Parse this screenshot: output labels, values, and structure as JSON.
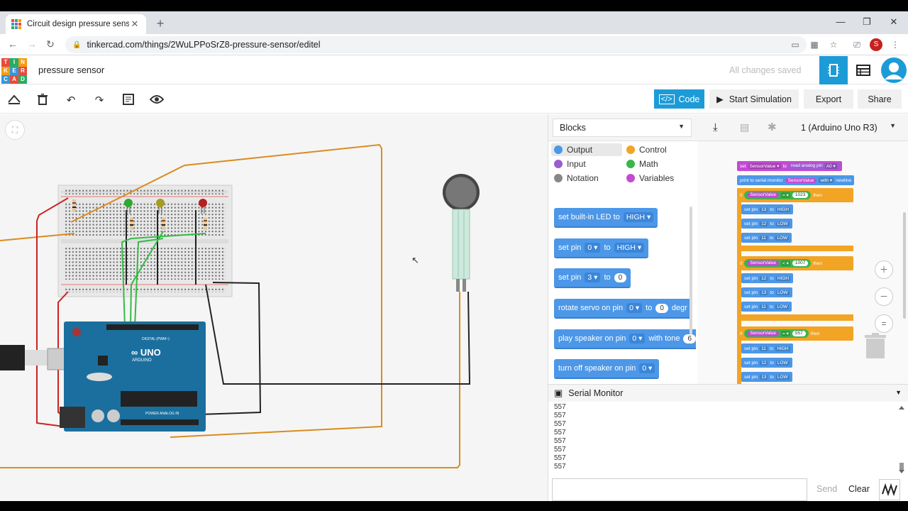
{
  "browser": {
    "tab_title": "Circuit design pressure sensor | T",
    "url": "tinkercad.com/things/2WuLPPoSrZ8-pressure-sensor/editel",
    "profile_initial": "S"
  },
  "app": {
    "logo_letters": [
      "T",
      "I",
      "N",
      "K",
      "E",
      "R",
      "C",
      "A",
      "D"
    ],
    "project_name": "pressure sensor",
    "save_status": "All changes saved"
  },
  "toolbar": {
    "code_label": "Code",
    "simulation_label": "Start Simulation",
    "export_label": "Export",
    "share_label": "Share"
  },
  "code_panel": {
    "mode_selected": "Blocks",
    "device_selected": "1 (Arduino Uno R3)",
    "categories": [
      "Output",
      "Control",
      "Input",
      "Math",
      "Notation",
      "Variables"
    ],
    "category_colors": {
      "Output": "#4c97e8",
      "Control": "#f2a424",
      "Input": "#9a5cd0",
      "Math": "#3cb54b",
      "Notation": "#888888",
      "Variables": "#c24bd3"
    },
    "palette": [
      {
        "text": "set built-in LED to",
        "dd": "HIGH"
      },
      {
        "text": "set pin",
        "dd": "0",
        "text2": "to",
        "dd2": "HIGH"
      },
      {
        "text": "set pin",
        "dd": "3",
        "text2": "to",
        "num": "0"
      },
      {
        "text": "rotate servo on pin",
        "dd": "0",
        "text2": "to",
        "num": "0",
        "text3": "degr"
      },
      {
        "text": "play speaker on pin",
        "dd": "0",
        "text2": "with tone",
        "num": "6"
      },
      {
        "text": "turn off speaker on pin",
        "dd": "0"
      }
    ],
    "workspace": {
      "set_label": "set",
      "var": "SensorValue",
      "to": "to",
      "read": "read analog pin",
      "pin": "A0",
      "print": "print to serial monitor",
      "with": "with",
      "newline": "newline",
      "if": "if",
      "then": "then",
      "eq": "=",
      "thresholds": [
        "1023",
        "1007",
        "557"
      ],
      "setpin": "set pin",
      "high": "HIGH",
      "low": "LOW",
      "groups": [
        [
          [
            "13",
            "HIGH"
          ],
          [
            "12",
            "LOW"
          ],
          [
            "11",
            "LOW"
          ]
        ],
        [
          [
            "12",
            "HIGH"
          ],
          [
            "13",
            "LOW"
          ],
          [
            "11",
            "LOW"
          ]
        ],
        [
          [
            "11",
            "HIGH"
          ],
          [
            "12",
            "LOW"
          ],
          [
            "13",
            "LOW"
          ]
        ]
      ]
    }
  },
  "serial": {
    "title": "Serial Monitor",
    "lines": [
      "557",
      "557",
      "557",
      "557",
      "557",
      "557",
      "557",
      "557"
    ],
    "send_label": "Send",
    "clear_label": "Clear"
  }
}
